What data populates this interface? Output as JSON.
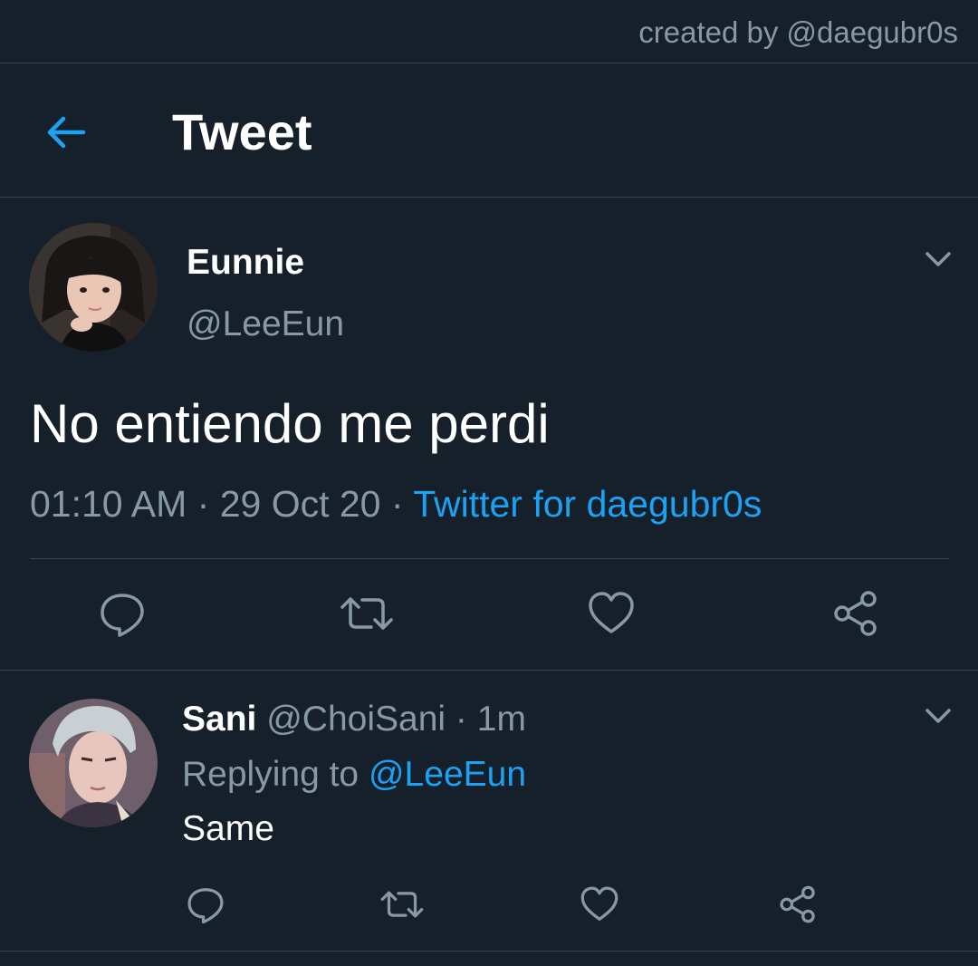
{
  "watermark": "created by @daegubr0s",
  "header": {
    "title": "Tweet"
  },
  "tweet": {
    "author": {
      "name": "Eunnie",
      "handle": "@LeeEun"
    },
    "text": "No entiendo me perdi",
    "time": "01:10 AM",
    "date": "29 Oct 20",
    "separator": "·",
    "source": "Twitter for daegubr0s"
  },
  "reply": {
    "author": {
      "name": "Sani",
      "handle": "@ChoiSani"
    },
    "separator": "·",
    "age": "1m",
    "replying_label": "Replying to",
    "replying_handle": "@LeeEun",
    "text": "Same"
  },
  "colors": {
    "background": "#15202b",
    "divider": "#38444d",
    "secondary_text": "#8899a6",
    "accent": "#1da1f2"
  },
  "icons": {
    "back": "arrow-left-icon",
    "menu": "chevron-down-icon",
    "reply": "comment-icon",
    "retweet": "retweet-icon",
    "like": "heart-icon",
    "share": "share-icon"
  }
}
